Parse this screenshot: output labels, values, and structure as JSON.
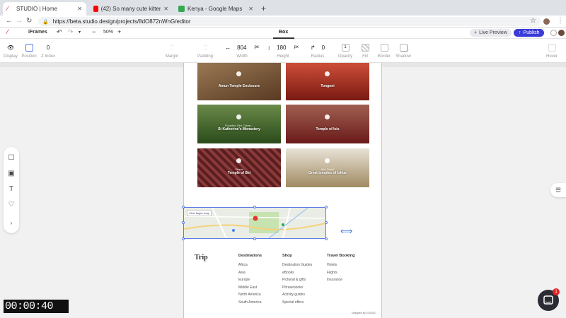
{
  "browser": {
    "tabs": [
      {
        "title": "STUDIO | Home",
        "active": true,
        "favicon_color": "#d0143a"
      },
      {
        "title": "(42) So many cute kittens vide...",
        "active": false,
        "favicon_color": "#ff0000"
      },
      {
        "title": "Kenya - Google Maps",
        "active": false,
        "favicon_color": "#34a853"
      }
    ],
    "url": "https://beta.studio.design/projects/8dO872nWnG/editor"
  },
  "studio_toolbar": {
    "element_name": "iFrames",
    "zoom": "50%",
    "active_panel": "Box",
    "live_preview_label": "Live Preview",
    "publish_label": "Publish"
  },
  "properties": {
    "display_label": "Display",
    "position_label": "Position",
    "zindex_value": "0",
    "zindex_label": "Z Index",
    "margin_label": "Margin",
    "padding_label": "Padding",
    "width_value": "804",
    "width_unit": "px",
    "width_label": "Width",
    "height_value": "180",
    "height_unit": "px",
    "height_label": "Height",
    "radius_value": "0",
    "radius_label": "Radius",
    "opacity_value": "1",
    "opacity_label": "Opacity",
    "fill_label": "Fill",
    "border_label": "Border",
    "shadow_label": "Shadow",
    "hover_label": "Hover"
  },
  "page": {
    "cards": [
      {
        "label": "Amun Temple Enclosure",
        "color": "#7a5a3a"
      },
      {
        "label": "Tongoni",
        "color": "#b03020"
      },
      {
        "label": "St Katherine's Monastery",
        "sub": "Founded Ulm Cuban...",
        "color": "#3b5a2a"
      },
      {
        "label": "Temple of Isis",
        "color": "#8a2a2a"
      },
      {
        "label": "Temple of Bel",
        "sub": "Sharia",
        "color": "#7a3030"
      },
      {
        "label": "Great temples of Ishtar",
        "sub": "Abu Dhabi",
        "color": "#b8a890"
      }
    ],
    "map_button": "View larger map",
    "footer": {
      "logo": "Trip",
      "columns": [
        {
          "heading": "Destinations",
          "items": [
            "Africa",
            "Asia",
            "Europe",
            "Middle East",
            "North America",
            "South America"
          ]
        },
        {
          "heading": "Shop",
          "items": [
            "Destination Guides",
            "eBooks",
            "Pictorial & gifts",
            "Phrasebooks",
            "Activity guides",
            "Special offers"
          ]
        },
        {
          "heading": "Travel Booking",
          "items": [
            "Hotels",
            "Flights",
            "Insurance"
          ]
        }
      ],
      "designed_by": "Designed by STUDIO"
    }
  },
  "overlay": {
    "timer": "00:00:40",
    "chat_badge": "1"
  }
}
